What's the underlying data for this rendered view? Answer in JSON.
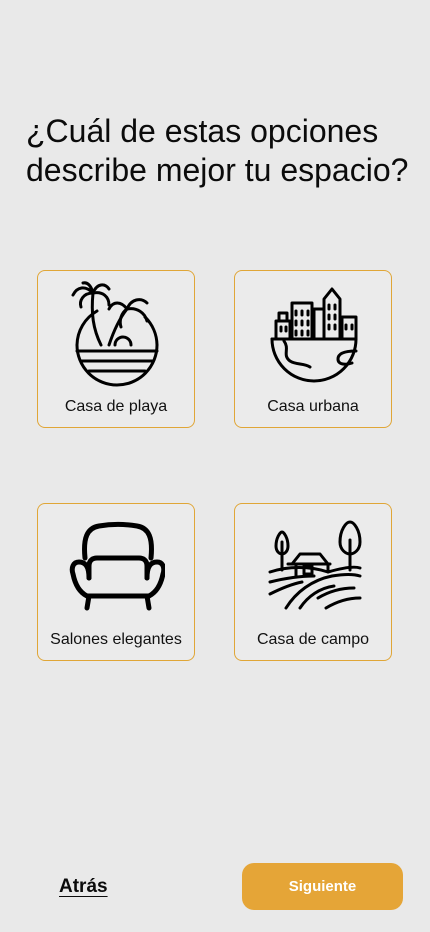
{
  "question": {
    "title": "¿Cuál de estas opciones describe mejor tu espacio?"
  },
  "options": [
    {
      "label": "Casa de playa",
      "icon": "beach-palm-icon"
    },
    {
      "label": "Casa urbana",
      "icon": "city-buildings-icon"
    },
    {
      "label": "Salones elegantes",
      "icon": "armchair-icon"
    },
    {
      "label": "Casa de campo",
      "icon": "farmhouse-fields-icon"
    }
  ],
  "footer": {
    "back_label": "Atrás",
    "next_label": "Siguiente"
  },
  "colors": {
    "background": "#e9e9e9",
    "accent": "#e5a537",
    "card_border": "#e0a637",
    "text": "#111111"
  }
}
